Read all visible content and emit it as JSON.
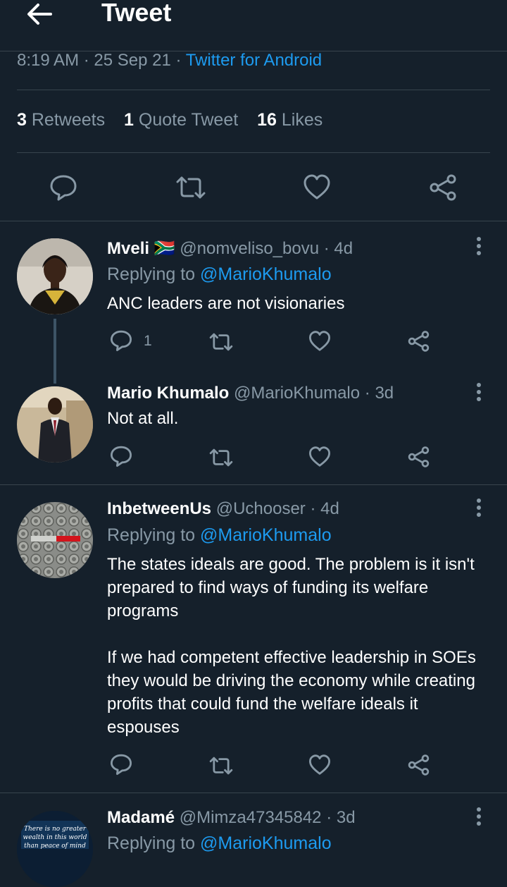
{
  "header": {
    "title": "Tweet"
  },
  "meta": {
    "time": "8:19 AM",
    "date": "25 Sep 21",
    "source": "Twitter for Android"
  },
  "stats": {
    "retweets_count": "3",
    "retweets_label": "Retweets",
    "quotes_count": "1",
    "quotes_label": "Quote Tweet",
    "likes_count": "16",
    "likes_label": "Likes"
  },
  "replies": [
    {
      "name": "Mveli",
      "flag": "🇿🇦",
      "handle": "@nomveliso_bovu",
      "age": "4d",
      "replying_label": "Replying to",
      "replying_to": "@MarioKhumalo",
      "text": "ANC leaders  are not visionaries",
      "reply_count": "1"
    },
    {
      "name": "Mario Khumalo",
      "handle": "@MarioKhumalo",
      "age": "3d",
      "text": "Not at all."
    },
    {
      "name": "InbetweenUs",
      "handle": "@Uchooser",
      "age": "4d",
      "replying_label": "Replying to",
      "replying_to": "@MarioKhumalo",
      "text": "The states ideals are good. The problem is it isn't prepared to find ways of funding its welfare programs\n\nIf we had competent effective leadership in SOEs they would be driving the economy while creating profits that could fund the welfare ideals it espouses"
    },
    {
      "name": "Madamé",
      "handle": "@Mimza47345842",
      "age": "3d",
      "replying_label": "Replying to",
      "replying_to": "@MarioKhumalo",
      "avatar_text": "There is no greater wealth in this world than peace of mind"
    }
  ],
  "colors": {
    "background": "#15202b",
    "accent": "#1d9bf0",
    "muted": "#8899a6",
    "divider": "#38444d"
  },
  "icons": [
    "back-arrow-icon",
    "reply-icon",
    "retweet-icon",
    "like-icon",
    "share-icon",
    "more-icon"
  ]
}
